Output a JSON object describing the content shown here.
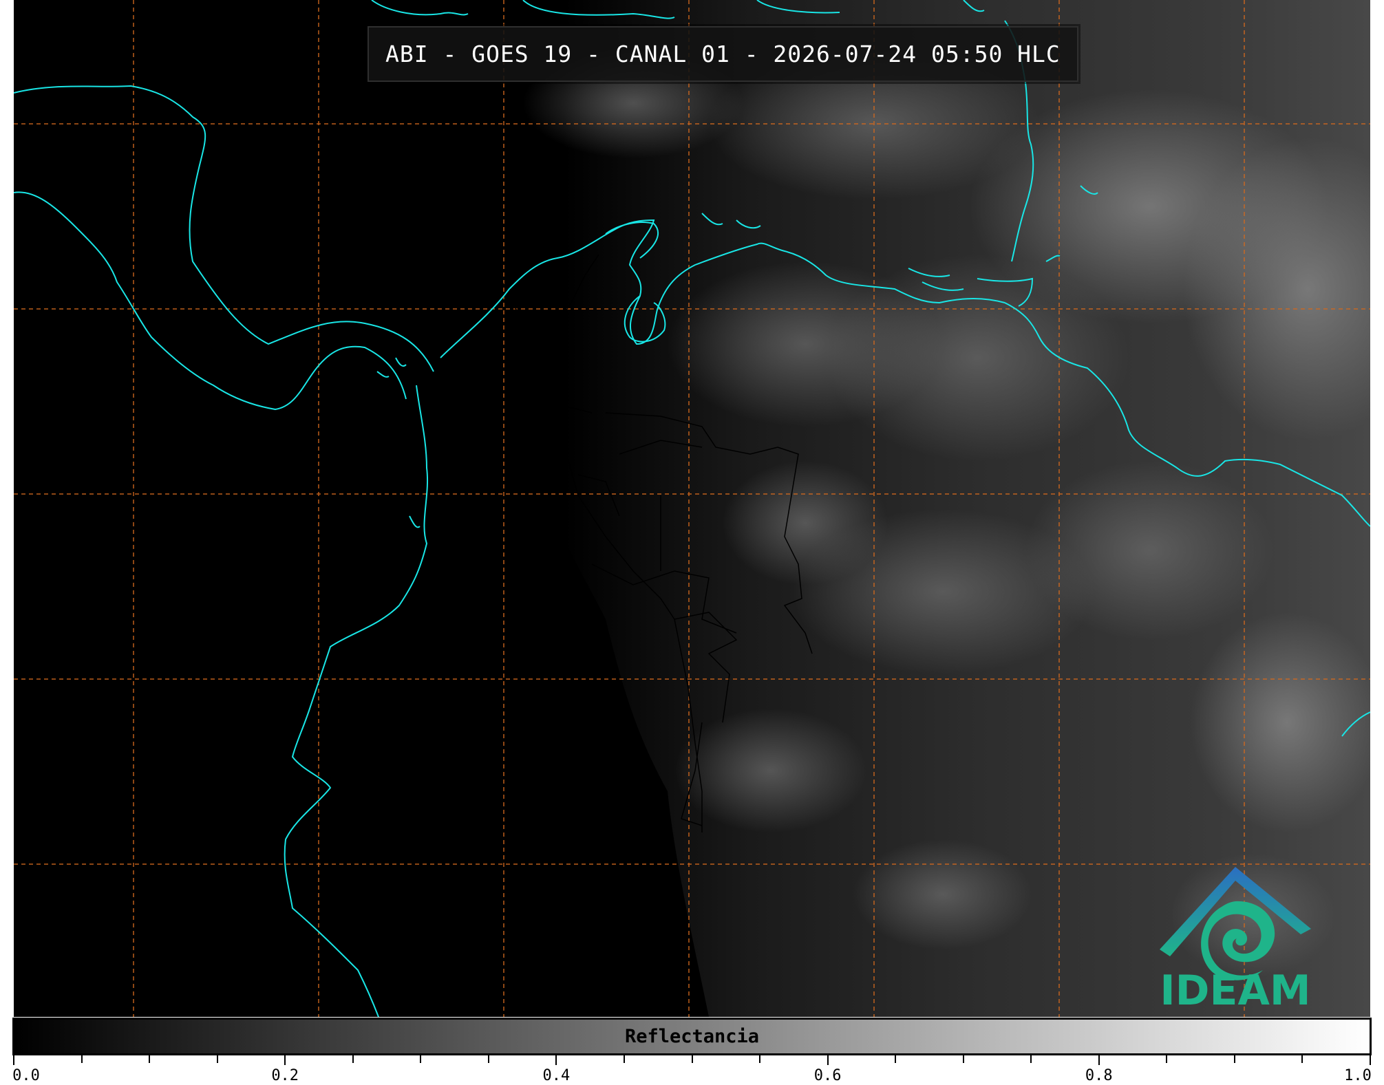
{
  "title": "ABI - GOES 19 - CANAL 01 - 2026-07-24 05:50 HLC",
  "logo": {
    "text": "IDEAM",
    "icon": "ideam-logo-icon",
    "colors": {
      "roof": "#2b6fc2",
      "swirl": "#1fb48a"
    }
  },
  "colorbar": {
    "label": "Reflectancia",
    "range": [
      0.0,
      1.0
    ],
    "ticks": [
      "0.0",
      "0.2",
      "0.4",
      "0.6",
      "0.8",
      "1.0"
    ],
    "minor_step": 0.05,
    "colormap": "gray"
  },
  "map": {
    "coastline_color": "#19e6e6",
    "grid_color": "#d2691e",
    "border_color": "#000000",
    "gridlines": "dashed",
    "background": "#000000"
  }
}
